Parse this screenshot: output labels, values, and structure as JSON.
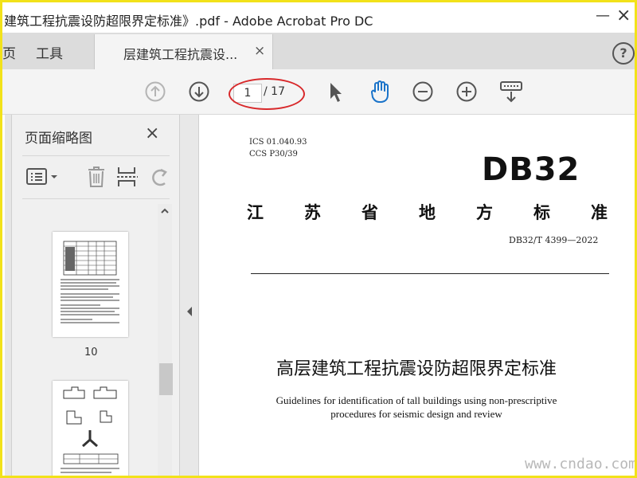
{
  "window": {
    "title": "建筑工程抗震设防超限界定标准》.pdf - Adobe Acrobat Pro DC",
    "minimize": "—",
    "close": "×"
  },
  "tabs": {
    "home_partial": "页",
    "tools": "工具",
    "doc_tab": "层建筑工程抗震设...",
    "doc_tab_close": "×",
    "help": "?"
  },
  "toolbar": {
    "page_current": "1",
    "page_total": "/ 17",
    "icons": [
      "page-up-icon",
      "page-down-icon",
      "select-arrow-icon",
      "hand-icon",
      "zoom-out-icon",
      "zoom-in-icon",
      "keyboard-down-icon"
    ],
    "annotation_color": "#d8282a",
    "hand_color": "#1a73c9"
  },
  "sidebar": {
    "title": "页面缩略图",
    "close": "×",
    "icons": [
      "thumbnail-options-icon",
      "delete-icon",
      "insert-page-icon",
      "undo-icon"
    ],
    "thumbs": [
      {
        "label": "10"
      }
    ]
  },
  "document": {
    "ics_line1": "ICS  01.040.93",
    "ics_line2": "CCS  P30/39",
    "code": "DB32",
    "category": [
      "江",
      "苏",
      "省",
      "地",
      "方",
      "标",
      "准"
    ],
    "standard_no": "DB32/T  4399—2022",
    "title_cn": "高层建筑工程抗震设防超限界定标准",
    "title_en_line1": "Guidelines for identification of tall buildings using non-prescriptive",
    "title_en_line2": "procedures for seismic design and review"
  },
  "watermark": "www.cndao.com",
  "colors": {
    "frame_border": "#f2e21a",
    "tab_bar": "#dcdcdc",
    "toolbar": "#f4f4f4"
  }
}
